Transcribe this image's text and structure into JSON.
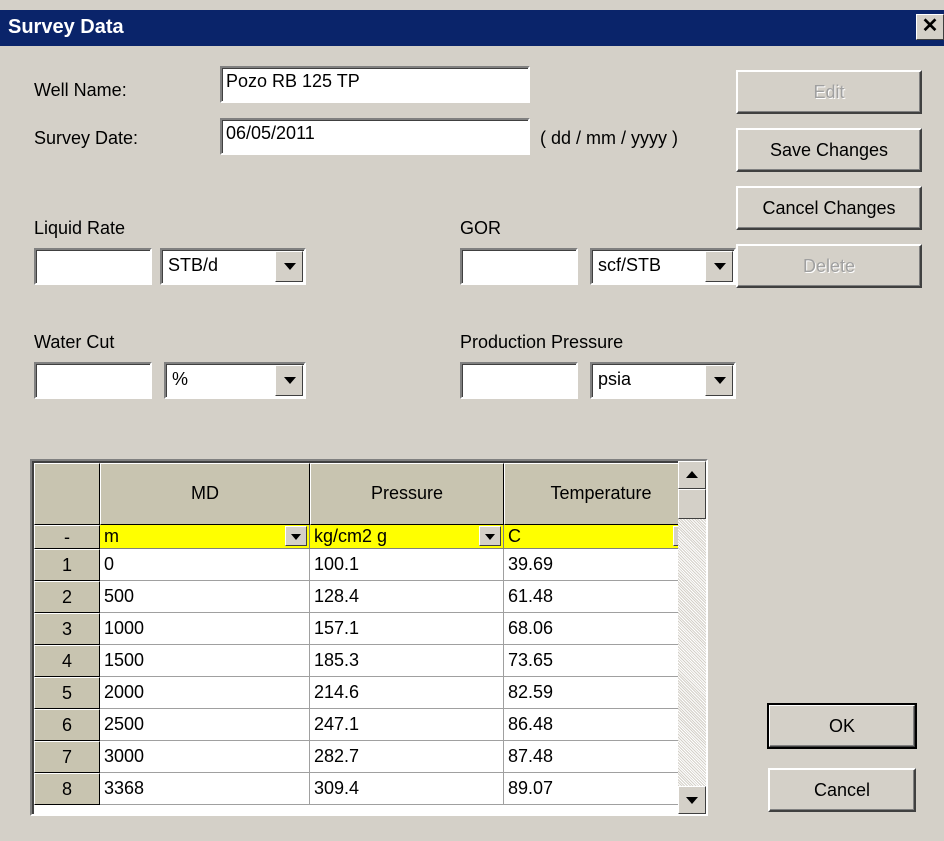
{
  "window": {
    "title": "Survey Data",
    "close_glyph": "✕"
  },
  "well_name": {
    "label": "Well Name:",
    "value": "Pozo RB 125 TP"
  },
  "survey_date": {
    "label": "Survey Date:",
    "value": "06/05/2011",
    "hint": "( dd / mm / yyyy )"
  },
  "liquid_rate": {
    "label": "Liquid Rate",
    "value": "",
    "unit": "STB/d"
  },
  "gor": {
    "label": "GOR",
    "value": "",
    "unit": "scf/STB"
  },
  "water_cut": {
    "label": "Water Cut",
    "value": "",
    "unit": "%"
  },
  "production_pressure": {
    "label": "Production Pressure",
    "value": "",
    "unit": "psia"
  },
  "buttons": {
    "edit": "Edit",
    "save_changes": "Save Changes",
    "cancel_changes": "Cancel Changes",
    "delete": "Delete",
    "ok": "OK",
    "cancel": "Cancel"
  },
  "grid": {
    "corner_label": "",
    "unit_row_label": "-",
    "columns": [
      "MD",
      "Pressure",
      "Temperature"
    ],
    "units": [
      "m",
      "kg/cm2 g",
      "C"
    ],
    "rows": [
      {
        "n": "1",
        "md": "0",
        "pressure": "100.1",
        "temperature": "39.69"
      },
      {
        "n": "2",
        "md": "500",
        "pressure": "128.4",
        "temperature": "61.48"
      },
      {
        "n": "3",
        "md": "1000",
        "pressure": "157.1",
        "temperature": "68.06"
      },
      {
        "n": "4",
        "md": "1500",
        "pressure": "185.3",
        "temperature": "73.65"
      },
      {
        "n": "5",
        "md": "2000",
        "pressure": "214.6",
        "temperature": "82.59"
      },
      {
        "n": "6",
        "md": "2500",
        "pressure": "247.1",
        "temperature": "86.48"
      },
      {
        "n": "7",
        "md": "3000",
        "pressure": "282.7",
        "temperature": "87.48"
      },
      {
        "n": "8",
        "md": "3368",
        "pressure": "309.4",
        "temperature": "89.07"
      }
    ]
  }
}
